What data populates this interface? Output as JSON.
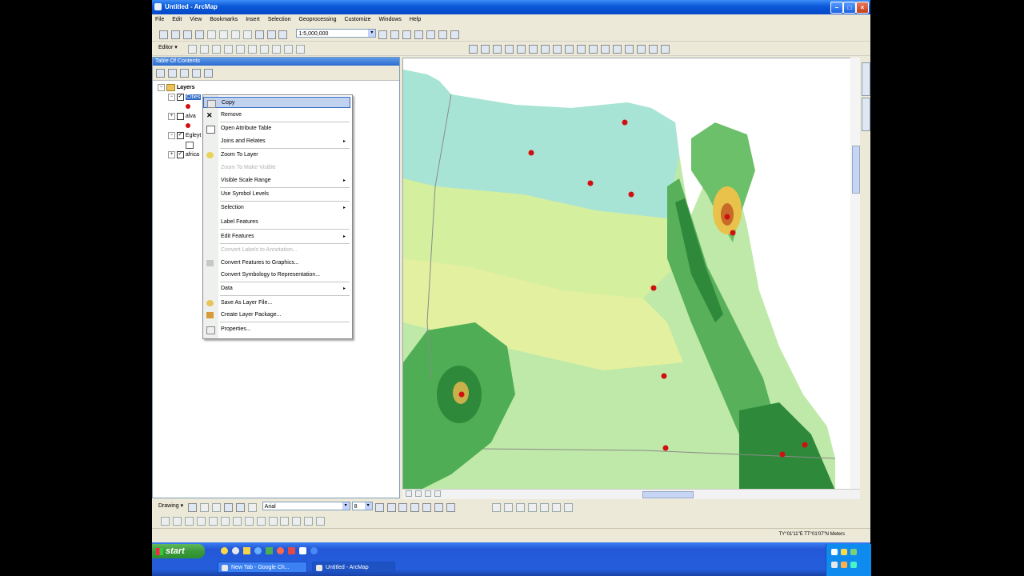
{
  "window": {
    "title": "Untitled - ArcMap"
  },
  "menu": [
    "File",
    "Edit",
    "View",
    "Bookmarks",
    "Insert",
    "Selection",
    "Geoprocessing",
    "Customize",
    "Windows",
    "Help"
  ],
  "toolbar": {
    "scale_value": "1:5,000,000",
    "editor_label": "Editor ▾"
  },
  "toc": {
    "title": "Table Of Contents",
    "root": "Layers",
    "layers": [
      {
        "name": "Cities",
        "checked": "✓"
      },
      {
        "name": "alva",
        "checked": ""
      },
      {
        "name": "Egleyt",
        "checked": "✓"
      },
      {
        "name": "africa",
        "checked": "✓"
      }
    ]
  },
  "context_menu": {
    "items": [
      {
        "label": "Copy",
        "submenu": ""
      },
      {
        "label": "Remove",
        "submenu": ""
      },
      {
        "label": "Open Attribute Table",
        "submenu": ""
      },
      {
        "label": "Joins and Relates",
        "submenu": "▸"
      },
      {
        "label": "Zoom To Layer",
        "submenu": ""
      },
      {
        "label": "Zoom To Make Visible",
        "submenu": ""
      },
      {
        "label": "Visible Scale Range",
        "submenu": "▸"
      },
      {
        "label": "Use Symbol Levels",
        "submenu": ""
      },
      {
        "label": "Selection",
        "submenu": "▸"
      },
      {
        "label": "Label Features",
        "submenu": ""
      },
      {
        "label": "Edit Features",
        "submenu": "▸"
      },
      {
        "label": "Convert Labels to Annotation...",
        "submenu": ""
      },
      {
        "label": "Convert Features to Graphics...",
        "submenu": ""
      },
      {
        "label": "Convert Symbology to Representation...",
        "submenu": ""
      },
      {
        "label": "Data",
        "submenu": "▸"
      },
      {
        "label": "Save As Layer File...",
        "submenu": ""
      },
      {
        "label": "Create Layer Package...",
        "submenu": ""
      },
      {
        "label": "Properties...",
        "submenu": ""
      }
    ]
  },
  "drawing": {
    "label": "Drawing ▾",
    "font": "Arial",
    "size": "8"
  },
  "status": {
    "coordinates": "TY°01'11\"E  TT°01'07\"N  Meters"
  },
  "taskbar": {
    "start": "start",
    "tasks": [
      "New Tab - Google Ch...",
      "Untitled - ArcMap"
    ]
  },
  "colors": {
    "accent": "#245edb",
    "point": "#d01010"
  }
}
